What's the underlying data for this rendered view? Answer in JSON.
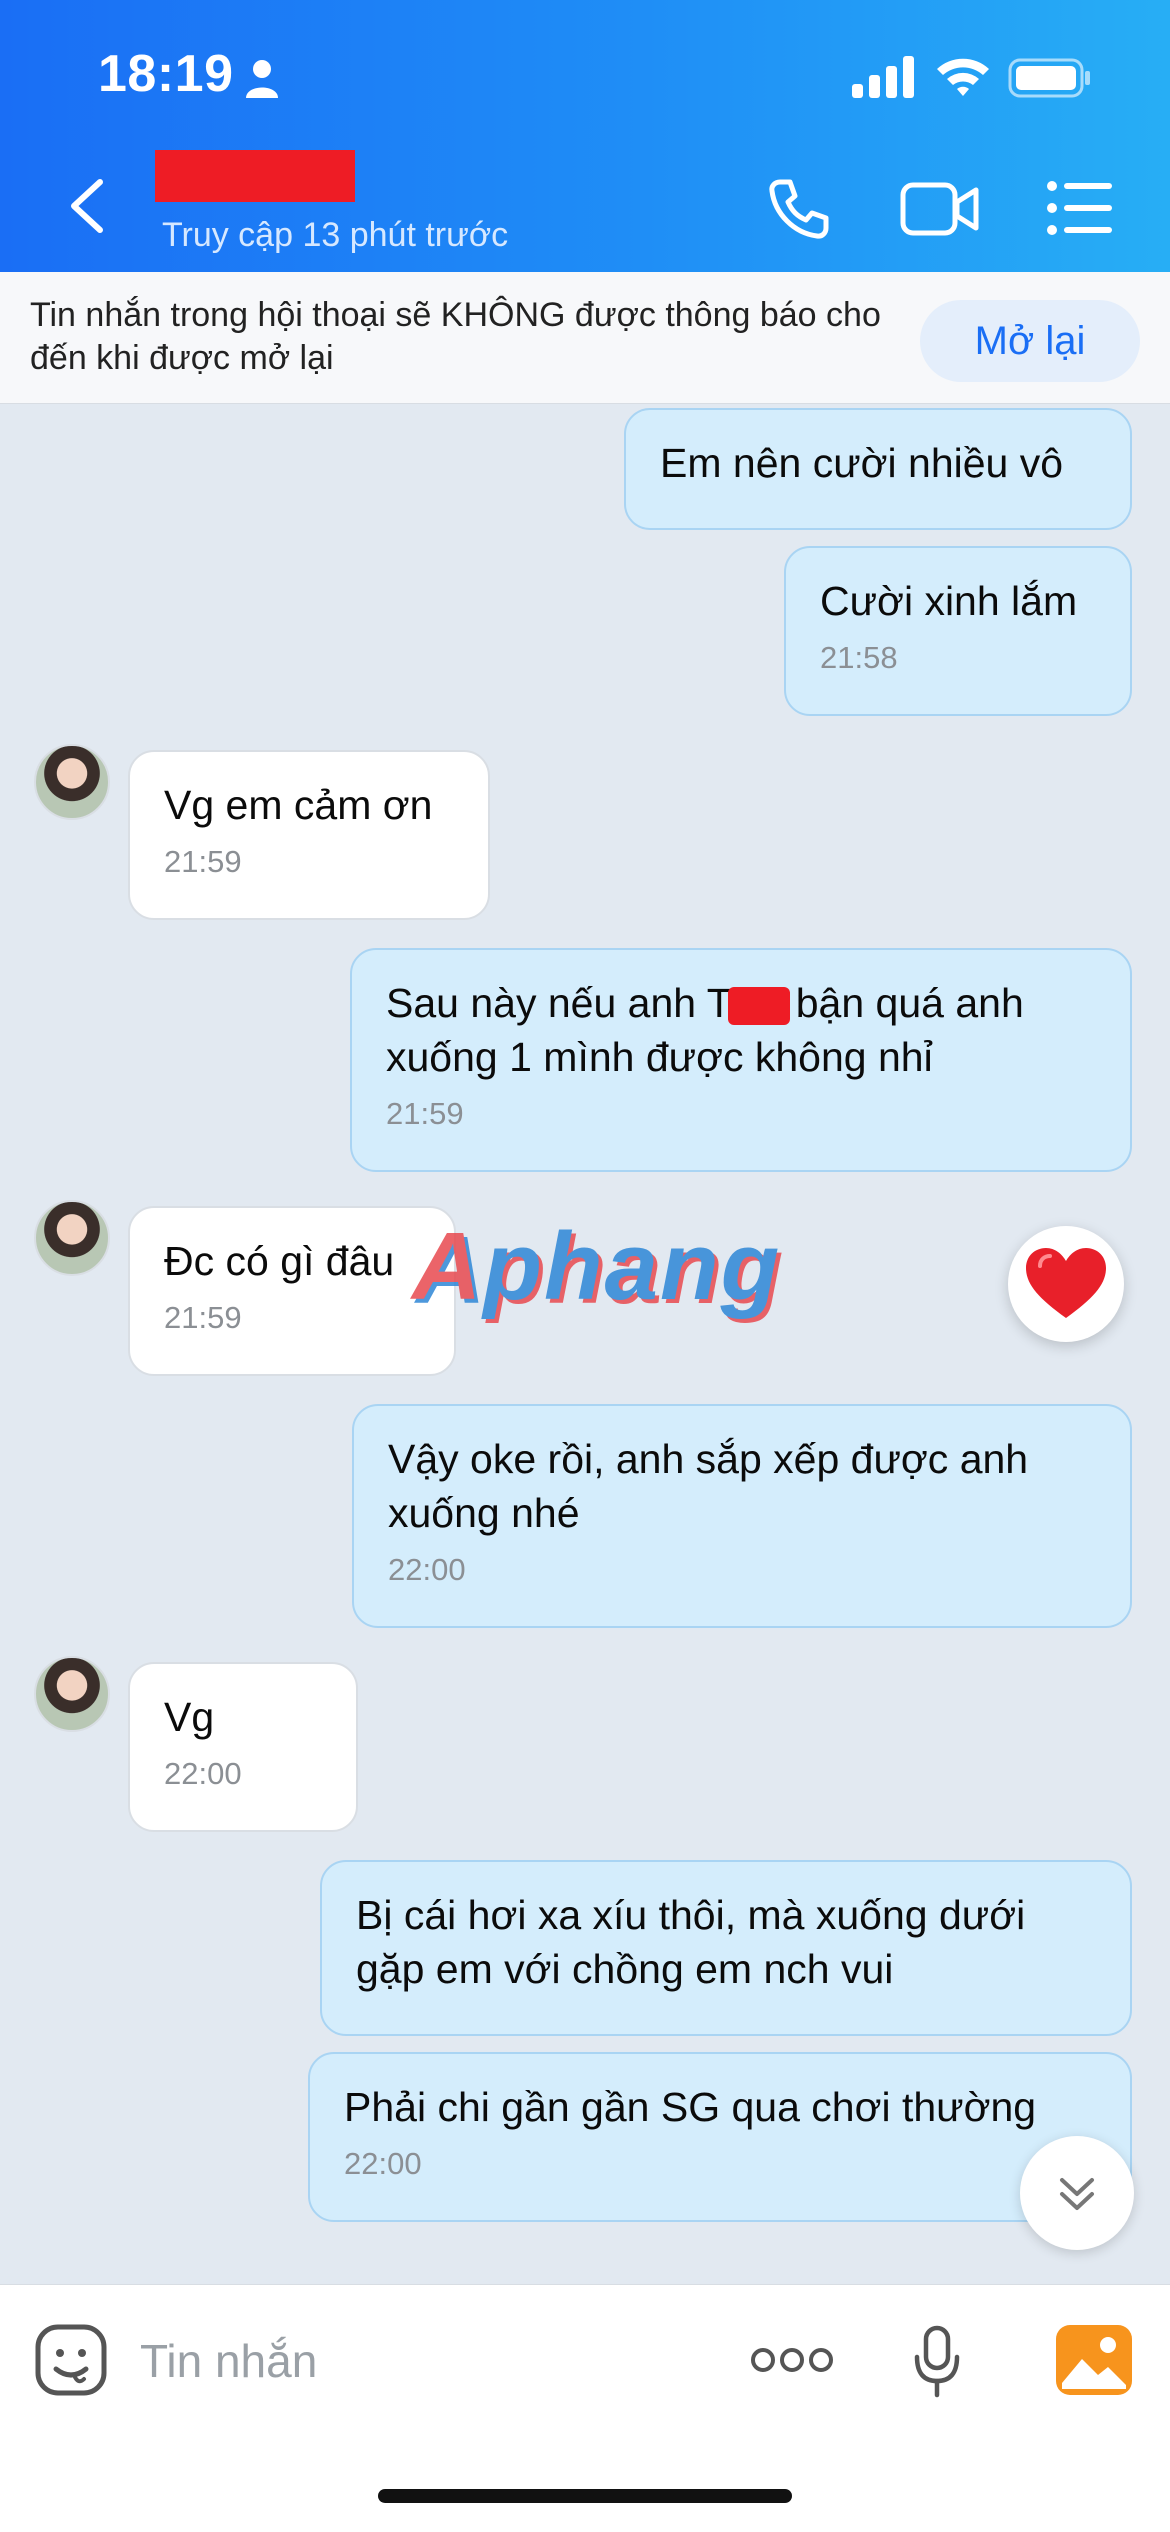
{
  "status_bar": {
    "time": "18:19"
  },
  "header": {
    "last_seen": "Truy cập 13 phút trước"
  },
  "notice": {
    "text": "Tin nhắn trong hội thoại sẽ KHÔNG được thông báo cho đến khi được mở lại",
    "button_label": "Mở lại"
  },
  "messages": [
    {
      "side": "mine",
      "text": "Em nên cười nhiều vô",
      "time": ""
    },
    {
      "side": "mine",
      "text": "Cười xinh lắm",
      "time": "21:58"
    },
    {
      "side": "theirs",
      "text": "Vg em cảm ơn",
      "time": "21:59"
    },
    {
      "side": "mine",
      "text_before": "Sau này nếu anh T",
      "text_after": "bận quá anh xuống 1 mình được không nhỉ",
      "time": "21:59"
    },
    {
      "side": "theirs",
      "text": "Đc có gì đâu",
      "time": "21:59"
    },
    {
      "side": "mine",
      "text": "Vậy oke rồi, anh sắp xếp được anh xuống nhé",
      "time": "22:00"
    },
    {
      "side": "theirs",
      "text": "Vg",
      "time": "22:00"
    },
    {
      "side": "mine",
      "text": "Bị cái hơi xa xíu thôi, mà xuống dưới gặp em với chồng em nch vui",
      "time": ""
    },
    {
      "side": "mine",
      "text": "Phải chi gần gần SG qua chơi thường",
      "time": "22:00"
    }
  ],
  "watermark": {
    "part1": "A",
    "part2": "phang"
  },
  "reaction": {
    "icon": "heart-icon",
    "color": "#e8202a"
  },
  "input_bar": {
    "placeholder": "Tin nhắn"
  },
  "colors": {
    "header_start": "#1a6ef5",
    "header_end": "#27aef5",
    "my_bubble": "#d4edfc",
    "their_bubble": "#ffffff",
    "accent": "#1a6ef5"
  }
}
